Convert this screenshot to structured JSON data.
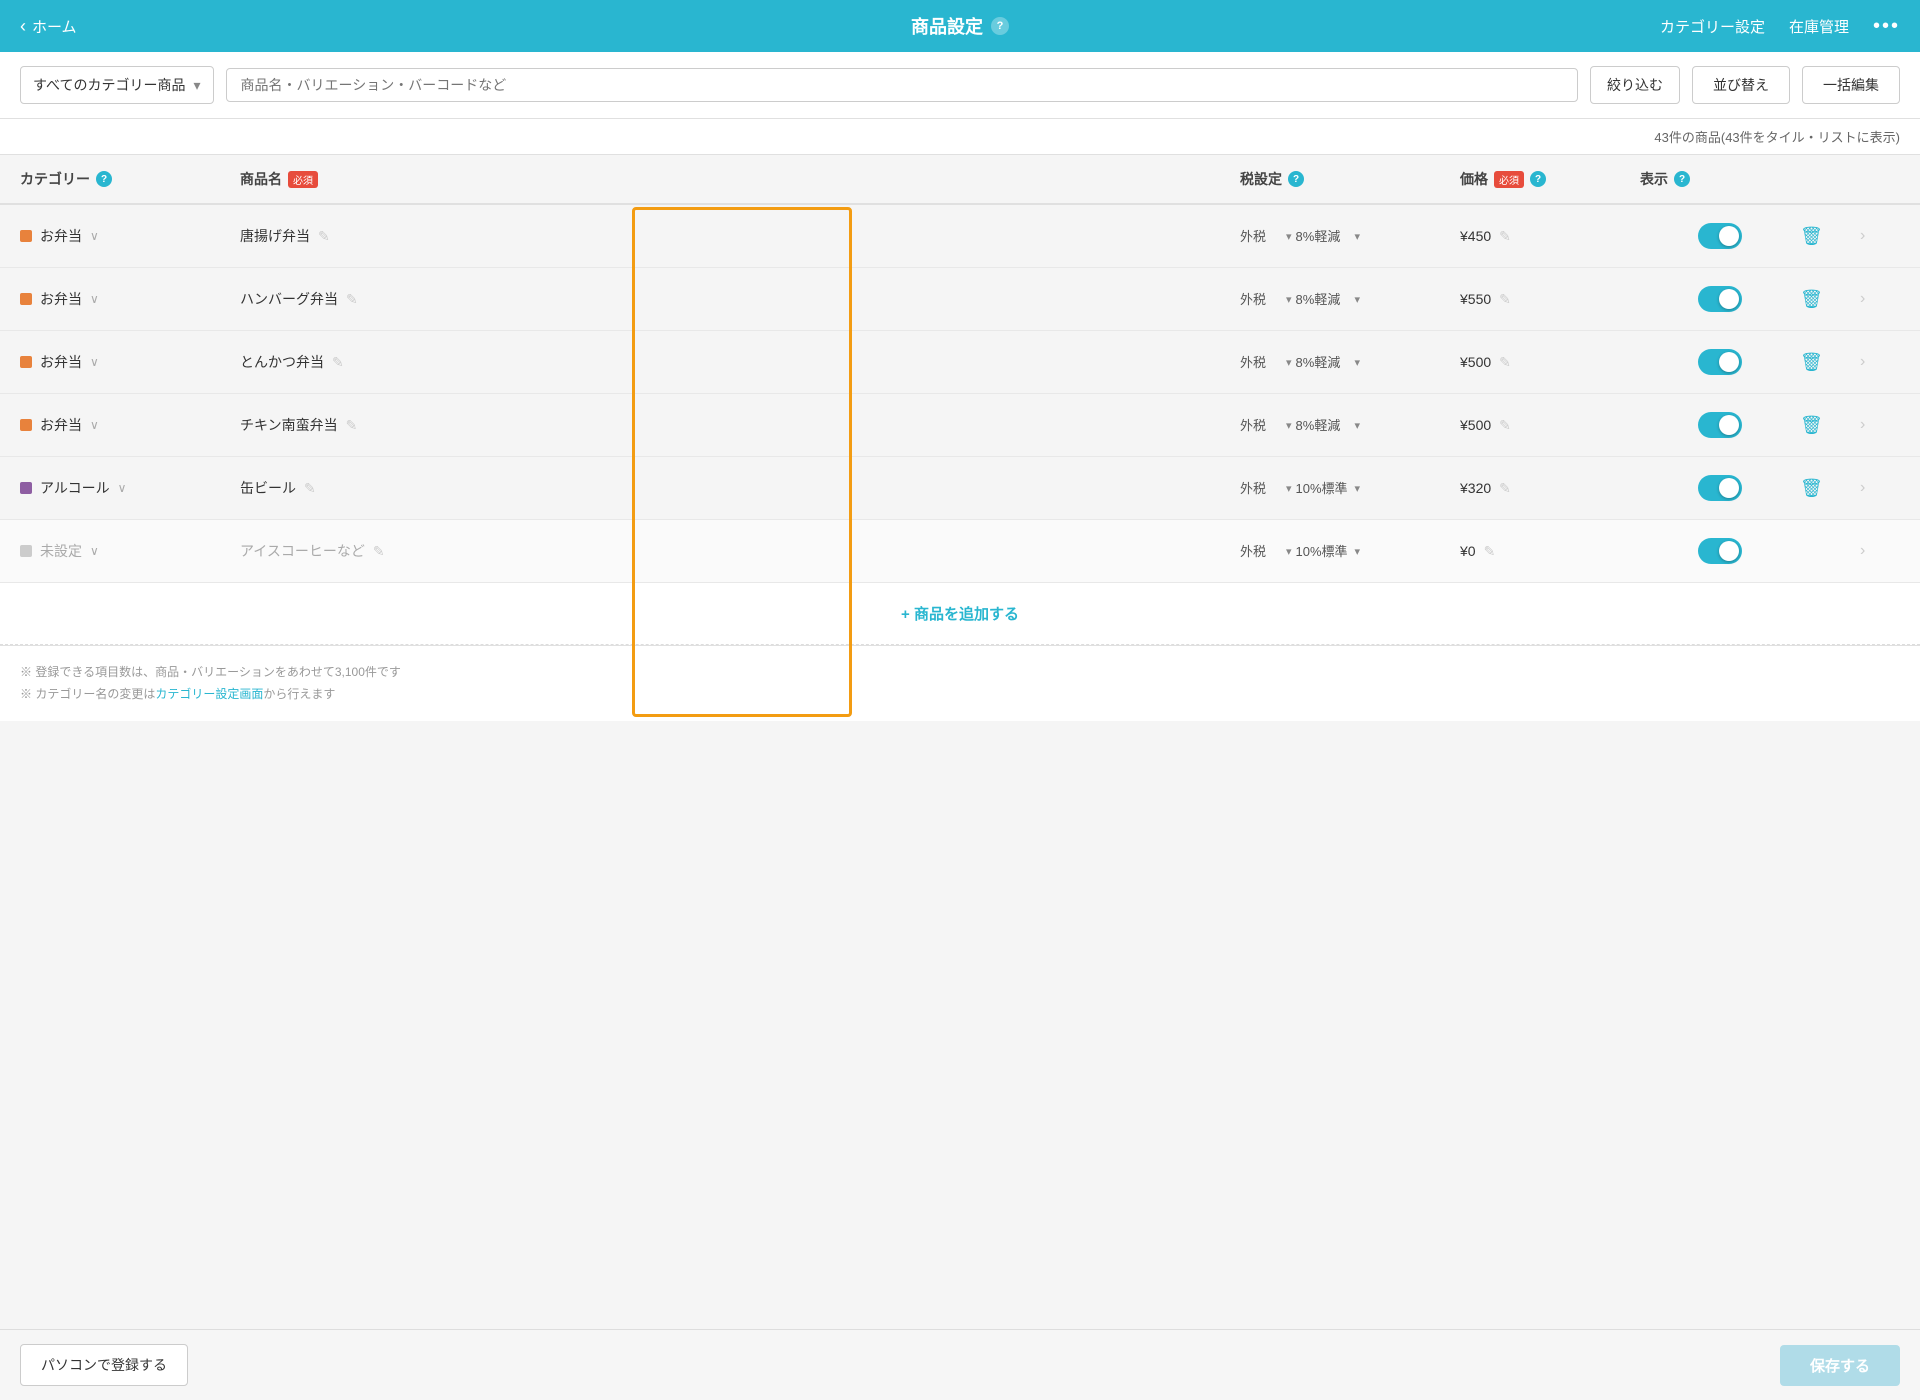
{
  "header": {
    "back_arrow": "‹",
    "back_label": "ホーム",
    "title": "商品設定",
    "help_label": "?",
    "nav_items": [
      "カテゴリー設定",
      "在庫管理"
    ],
    "dots": "•••"
  },
  "toolbar": {
    "category_select": "すべてのカテゴリー商品",
    "search_placeholder": "商品名・バリエーション・バーコードなど",
    "filter_btn": "絞り込む",
    "sort_btn": "並び替え",
    "bulk_edit_btn": "一括編集"
  },
  "count_info": "43件の商品(43件をタイル・リストに表示)",
  "table": {
    "headers": {
      "category": "カテゴリー",
      "product_name": "商品名",
      "required_badge": "必須",
      "tax_setting": "税設定",
      "price": "価格",
      "display": "表示"
    },
    "rows": [
      {
        "id": 1,
        "category_color": "#e8823c",
        "category": "お弁当",
        "product": "唐揚げ弁当",
        "tax_type": "外税",
        "tax_rate": "8%軽減",
        "price": "¥450",
        "enabled": true,
        "highlighted": true
      },
      {
        "id": 2,
        "category_color": "#e8823c",
        "category": "お弁当",
        "product": "ハンバーグ弁当",
        "tax_type": "外税",
        "tax_rate": "8%軽減",
        "price": "¥550",
        "enabled": true,
        "highlighted": true
      },
      {
        "id": 3,
        "category_color": "#e8823c",
        "category": "お弁当",
        "product": "とんかつ弁当",
        "tax_type": "外税",
        "tax_rate": "8%軽減",
        "price": "¥500",
        "enabled": true,
        "highlighted": true
      },
      {
        "id": 4,
        "category_color": "#e8823c",
        "category": "お弁当",
        "product": "チキン南蛮弁当",
        "tax_type": "外税",
        "tax_rate": "8%軽減",
        "price": "¥500",
        "enabled": true,
        "highlighted": true
      },
      {
        "id": 5,
        "category_color": "#8e5ea2",
        "category": "アルコール",
        "product": "缶ビール",
        "tax_type": "外税",
        "tax_rate": "10%標準",
        "price": "¥320",
        "enabled": true,
        "highlighted": true
      },
      {
        "id": 6,
        "category_color": "#ccc",
        "category": "未設定",
        "product": "アイスコーヒーなど",
        "tax_type": "外税",
        "tax_rate": "10%標準",
        "price": "¥0",
        "enabled": true,
        "highlighted": false,
        "unset": true
      }
    ]
  },
  "add_product_btn": "+ 商品を追加する",
  "footer": {
    "line1": "※ 登録できる項目数は、商品・バリエーションをあわせて3,100件です",
    "line2": "※ カテゴリー名の変更はカテゴリー設定画面から行えます"
  },
  "bottom_bar": {
    "register_pc_btn": "パソコンで登録する",
    "save_btn": "保存する"
  }
}
